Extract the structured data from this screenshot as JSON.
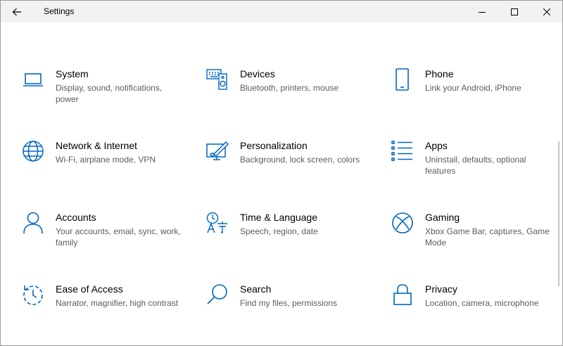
{
  "window": {
    "title": "Settings",
    "accent_color": "#0067c0",
    "controls": {
      "back": "back-arrow-icon",
      "minimize": "minimize-icon",
      "maximize": "maximize-icon",
      "close": "close-icon"
    }
  },
  "categories": [
    {
      "name": "System",
      "description": "Display, sound, notifications, power",
      "icon": "laptop-icon"
    },
    {
      "name": "Devices",
      "description": "Bluetooth, printers, mouse",
      "icon": "devices-icon"
    },
    {
      "name": "Phone",
      "description": "Link your Android, iPhone",
      "icon": "phone-icon"
    },
    {
      "name": "Network & Internet",
      "description": "Wi-Fi, airplane mode, VPN",
      "icon": "globe-icon"
    },
    {
      "name": "Personalization",
      "description": "Background, lock screen, colors",
      "icon": "personalization-icon"
    },
    {
      "name": "Apps",
      "description": "Uninstall, defaults, optional features",
      "icon": "apps-list-icon"
    },
    {
      "name": "Accounts",
      "description": "Your accounts, email, sync, work, family",
      "icon": "person-icon"
    },
    {
      "name": "Time & Language",
      "description": "Speech, region, date",
      "icon": "time-language-icon"
    },
    {
      "name": "Gaming",
      "description": "Xbox Game Bar, captures, Game Mode",
      "icon": "xbox-icon"
    },
    {
      "name": "Ease of Access",
      "description": "Narrator, magnifier, high contrast",
      "icon": "ease-of-access-icon"
    },
    {
      "name": "Search",
      "description": "Find my files, permissions",
      "icon": "search-icon"
    },
    {
      "name": "Privacy",
      "description": "Location, camera, microphone",
      "icon": "lock-icon"
    }
  ]
}
